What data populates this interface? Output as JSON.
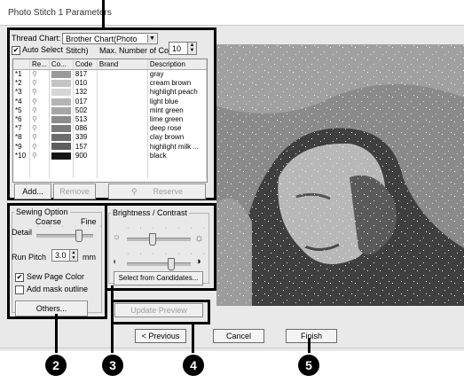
{
  "window": {
    "title": "Photo Stitch 1 Parameters"
  },
  "thread": {
    "chart_label": "Thread Chart:",
    "chart_value": "Brother Chart(Photo Stitch)",
    "auto_select_label": "Auto Select",
    "auto_select_checked": true,
    "max_colors_label": "Max. Number of Colors:",
    "max_colors_value": "10",
    "columns": [
      "Re...",
      "Co...",
      "Code",
      "Brand",
      "Description"
    ],
    "rows": [
      {
        "idx": "*1",
        "code": "817",
        "brand": "",
        "desc": "gray",
        "color": "#9a9a9a"
      },
      {
        "idx": "*2",
        "code": "010",
        "brand": "",
        "desc": "cream brown",
        "color": "#c4c4c4"
      },
      {
        "idx": "*3",
        "code": "132",
        "brand": "",
        "desc": "highlight peach",
        "color": "#d6d6d6"
      },
      {
        "idx": "*4",
        "code": "017",
        "brand": "",
        "desc": "light blue",
        "color": "#b4b4b4"
      },
      {
        "idx": "*5",
        "code": "502",
        "brand": "",
        "desc": "mint green",
        "color": "#a6a6a6"
      },
      {
        "idx": "*6",
        "code": "513",
        "brand": "",
        "desc": "lime green",
        "color": "#8c8c8c"
      },
      {
        "idx": "*7",
        "code": "086",
        "brand": "",
        "desc": "deep rose",
        "color": "#7a7a7a"
      },
      {
        "idx": "*8",
        "code": "339",
        "brand": "",
        "desc": "clay brown",
        "color": "#6c6c6c"
      },
      {
        "idx": "*9",
        "code": "157",
        "brand": "",
        "desc": "highlight milk ...",
        "color": "#5e5e5e"
      },
      {
        "idx": "*10",
        "code": "900",
        "brand": "",
        "desc": "black",
        "color": "#161616"
      }
    ],
    "add_label": "Add...",
    "remove_label": "Remove",
    "reserve_label": "Reserve"
  },
  "sewing": {
    "group_label": "Sewing Option",
    "coarse_label": "Coarse",
    "fine_label": "Fine",
    "detail_label": "Detail",
    "detail_level": 0.75,
    "run_pitch_label": "Run Pitch",
    "run_pitch_value": "3.0",
    "run_pitch_unit": "mm",
    "sew_page_color_label": "Sew Page Color",
    "sew_page_color_checked": true,
    "add_mask_outline_label": "Add mask outline",
    "add_mask_outline_checked": false,
    "others_label": "Others..."
  },
  "brightness": {
    "group_label": "Brightness / Contrast",
    "brightness_level": 0.4,
    "contrast_level": 0.7,
    "select_candidates_label": "Select from Candidates..."
  },
  "preview": {
    "update_label": "Update Preview"
  },
  "footer": {
    "previous_label": "< Previous",
    "cancel_label": "Cancel",
    "finish_label": "Finish"
  },
  "callouts": [
    "2",
    "3",
    "4",
    "5"
  ],
  "icons": {
    "sun_small": "☼",
    "sun_large": "☼",
    "contrast_left": "◐",
    "contrast_right": "◑",
    "pin": "⊣"
  }
}
